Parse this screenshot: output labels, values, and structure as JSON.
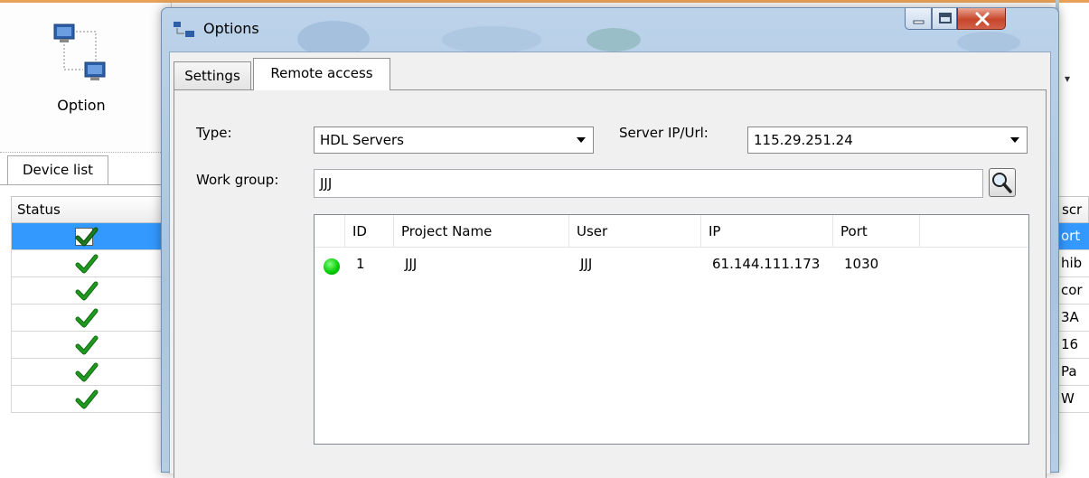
{
  "background_app": {
    "ribbon": {
      "option_label": "Option"
    },
    "device_tab_label": "Device list",
    "device_table": {
      "status_header": "Status",
      "rows": [
        {
          "status": "ok",
          "selected": true
        },
        {
          "status": "ok",
          "selected": false
        },
        {
          "status": "ok",
          "selected": false
        },
        {
          "status": "ok",
          "selected": false
        },
        {
          "status": "ok",
          "selected": false
        },
        {
          "status": "ok",
          "selected": false
        },
        {
          "status": "ok",
          "selected": false
        }
      ]
    },
    "right_column": {
      "header": "scr",
      "cells": [
        "ort",
        "hib",
        "cor",
        "3A",
        "16",
        "Pa",
        "W"
      ]
    }
  },
  "dialog": {
    "title": "Options",
    "tabs": [
      {
        "label": "Settings",
        "active": false
      },
      {
        "label": "Remote access",
        "active": true
      }
    ],
    "type_label": "Type:",
    "type_value": "HDL Servers",
    "server_label": "Server IP/Url:",
    "server_value": "115.29.251.24",
    "workgroup_label": "Work group:",
    "workgroup_value": "JJJ",
    "table": {
      "columns": [
        "ID",
        "Project Name",
        "User",
        "IP",
        "Port"
      ],
      "rows": [
        {
          "online": true,
          "id": "1",
          "project": "JJJ",
          "user": "JJJ",
          "ip": "61.144.111.173",
          "port": "1030"
        }
      ]
    }
  },
  "colors": {
    "selection": "#3399ff",
    "check_green": "#1f9a1f",
    "online_green": "#00c800",
    "close_red": "#c7462b"
  }
}
